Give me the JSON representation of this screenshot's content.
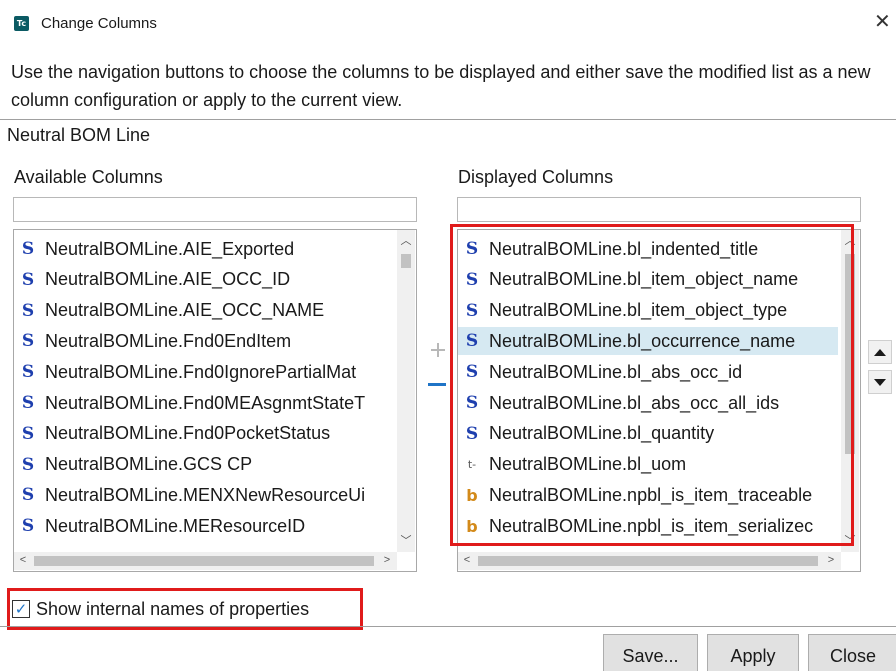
{
  "window": {
    "title": "Change Columns",
    "app_icon_text": "Tc",
    "close_glyph": "✕"
  },
  "instructions": "Use the navigation buttons to choose the columns to be displayed and either save the modified list as a new column configuration or apply to the current view.",
  "section_label": "Neutral BOM Line",
  "available": {
    "label": "Available Columns",
    "filter_value": "",
    "items": [
      {
        "icon": "S",
        "type": "string",
        "text": "NeutralBOMLine.AIE_Exported"
      },
      {
        "icon": "S",
        "type": "string",
        "text": "NeutralBOMLine.AIE_OCC_ID"
      },
      {
        "icon": "S",
        "type": "string",
        "text": "NeutralBOMLine.AIE_OCC_NAME"
      },
      {
        "icon": "S",
        "type": "string",
        "text": "NeutralBOMLine.Fnd0EndItem"
      },
      {
        "icon": "S",
        "type": "string",
        "text": "NeutralBOMLine.Fnd0IgnorePartialMat"
      },
      {
        "icon": "S",
        "type": "string",
        "text": "NeutralBOMLine.Fnd0MEAsgnmtStateT"
      },
      {
        "icon": "S",
        "type": "string",
        "text": "NeutralBOMLine.Fnd0PocketStatus"
      },
      {
        "icon": "S",
        "type": "string",
        "text": "NeutralBOMLine.GCS CP"
      },
      {
        "icon": "S",
        "type": "string",
        "text": "NeutralBOMLine.MENXNewResourceUi"
      },
      {
        "icon": "S",
        "type": "string",
        "text": "NeutralBOMLine.MEResourceID"
      }
    ]
  },
  "displayed": {
    "label": "Displayed Columns",
    "filter_value": "",
    "items": [
      {
        "icon": "S",
        "type": "string",
        "text": "NeutralBOMLine.bl_indented_title"
      },
      {
        "icon": "S",
        "type": "string",
        "text": "NeutralBOMLine.bl_item_object_name"
      },
      {
        "icon": "S",
        "type": "string",
        "text": "NeutralBOMLine.bl_item_object_type"
      },
      {
        "icon": "S",
        "type": "string",
        "text": "NeutralBOMLine.bl_occurrence_name",
        "selected": true
      },
      {
        "icon": "S",
        "type": "string",
        "text": "NeutralBOMLine.bl_abs_occ_id"
      },
      {
        "icon": "S",
        "type": "string",
        "text": "NeutralBOMLine.bl_abs_occ_all_ids"
      },
      {
        "icon": "S",
        "type": "string",
        "text": "NeutralBOMLine.bl_quantity"
      },
      {
        "icon": "t-",
        "type": "typed-ref",
        "text": "NeutralBOMLine.bl_uom"
      },
      {
        "icon": "b",
        "type": "boolean",
        "text": "NeutralBOMLine.npbl_is_item_traceable"
      },
      {
        "icon": "b",
        "type": "boolean",
        "text": "NeutralBOMLine.npbl_is_item_serializec"
      }
    ]
  },
  "transfer": {
    "add_glyph": "+",
    "remove_glyph": "−"
  },
  "checkbox": {
    "label": "Show internal names of properties",
    "checked": true,
    "check_glyph": "✓"
  },
  "buttons": {
    "save": "Save...",
    "apply": "Apply",
    "close": "Close"
  },
  "colors": {
    "highlight_box": "#e01b1b",
    "selection": "#d6e9f2",
    "string_icon": "#1e3fae",
    "boolean_icon": "#d38a1a"
  }
}
